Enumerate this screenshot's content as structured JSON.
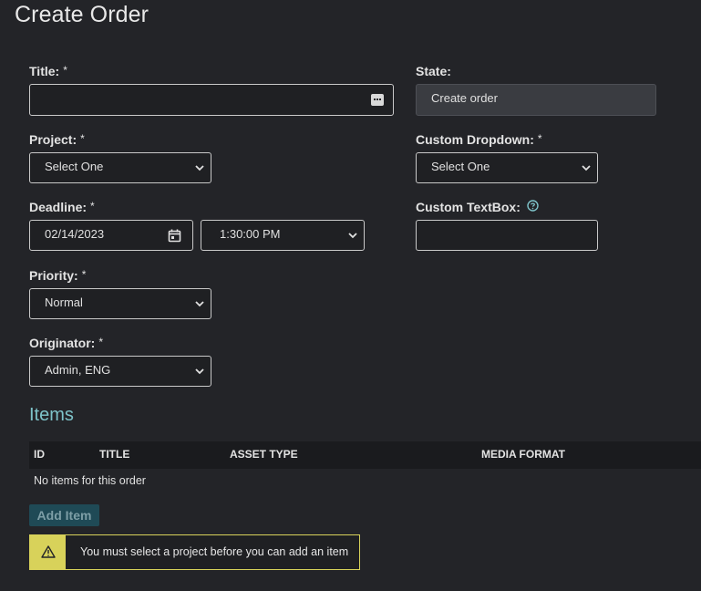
{
  "page": {
    "title": "Create Order"
  },
  "form": {
    "title": {
      "label": "Title:",
      "required": "*",
      "value": ""
    },
    "state": {
      "label": "State:",
      "value": "Create order"
    },
    "project": {
      "label": "Project:",
      "required": "*",
      "value": "Select One"
    },
    "custom_dropdown": {
      "label": "Custom Dropdown:",
      "required": "*",
      "value": "Select One"
    },
    "deadline": {
      "label": "Deadline:",
      "required": "*",
      "date": "02/14/2023",
      "time": "1:30:00 PM"
    },
    "custom_textbox": {
      "label": "Custom TextBox:",
      "value": ""
    },
    "priority": {
      "label": "Priority:",
      "required": "*",
      "value": "Normal"
    },
    "originator": {
      "label": "Originator:",
      "required": "*",
      "value": "Admin, ENG"
    }
  },
  "items": {
    "heading": "Items",
    "columns": [
      "ID",
      "TITLE",
      "ASSET TYPE",
      "MEDIA FORMAT"
    ],
    "empty_text": "No items for this order",
    "add_label": "Add Item"
  },
  "warning": {
    "message": "You must select a project before you can add an item"
  },
  "colors": {
    "background": "#232428",
    "accent_heading": "#7ec3c9",
    "warning": "#d8d25a",
    "button": "#1f4a56"
  }
}
